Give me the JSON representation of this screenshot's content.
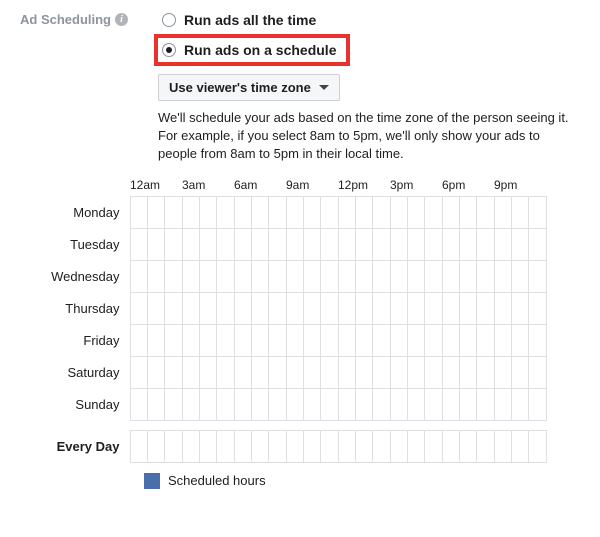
{
  "section_label": "Ad Scheduling",
  "radios": {
    "all_time": "Run ads all the time",
    "on_schedule": "Run ads on a schedule"
  },
  "timezone_dropdown": "Use viewer's time zone",
  "help_text_1": "We'll schedule your ads based on the time zone of the person seeing it.",
  "help_text_2": "For example, if you select 8am to 5pm, we'll only show your ads to people from 8am to 5pm in their local time.",
  "time_headers": [
    "12am",
    "3am",
    "6am",
    "9am",
    "12pm",
    "3pm",
    "6pm",
    "9pm"
  ],
  "days": [
    "Monday",
    "Tuesday",
    "Wednesday",
    "Thursday",
    "Friday",
    "Saturday",
    "Sunday"
  ],
  "every_day_label": "Every Day",
  "legend_label": "Scheduled hours"
}
